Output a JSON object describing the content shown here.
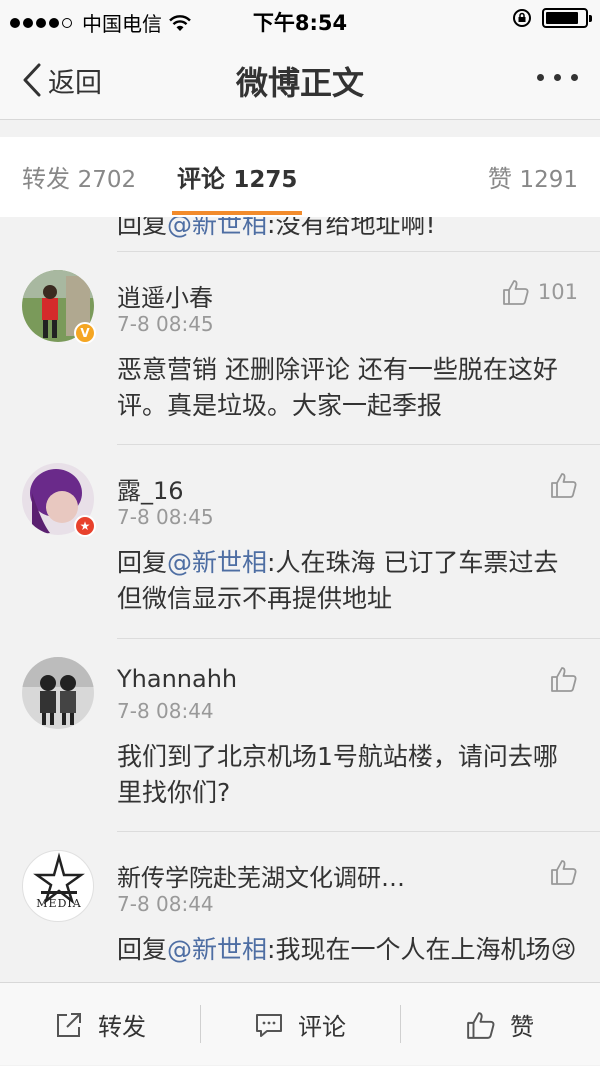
{
  "status_bar": {
    "carrier": "中国电信",
    "time": "下午8:54",
    "battery_level": 0.85
  },
  "nav": {
    "back_label": "返回",
    "title": "微博正文"
  },
  "tabs": {
    "repost_label": "转发",
    "repost_count": "2702",
    "comment_label": "评论",
    "comment_count": "1275",
    "like_label": "赞",
    "like_count": "1291"
  },
  "partial_comment": {
    "prefix": "回复",
    "mention": "@新世相",
    "text": ":没有给地址啊!"
  },
  "comments": [
    {
      "username": "逍遥小春",
      "time": "7-8 08:45",
      "text": "恶意营销 还删除评论 还有一些脱在这好评。真是垃圾。大家一起季报",
      "likes": "101",
      "badge": "V"
    },
    {
      "username": "露_16",
      "time": "7-8 08:45",
      "prefix": "回复",
      "mention": "@新世相",
      "text": ":人在珠海 已订了车票过去 但微信显示不再提供地址",
      "likes": ""
    },
    {
      "username": "Yhannahh",
      "time": "7-8 08:44",
      "text": "我们到了北京机场1号航站楼，请问去哪里找你们?",
      "likes": ""
    },
    {
      "username": "新传学院赴芜湖文化调研…",
      "time": "7-8 08:44",
      "prefix": "回复",
      "mention": "@新世相",
      "text": ":我现在一个人在上海机场😢",
      "likes": "",
      "avatar_text": "MEDIA"
    }
  ],
  "bottom_bar": {
    "repost": "转发",
    "comment": "评论",
    "like": "赞"
  },
  "colors": {
    "accent": "#f28b2c",
    "mention": "#4e6ea3",
    "verified_badge": "#f5a623",
    "red_badge": "#e8412c"
  }
}
